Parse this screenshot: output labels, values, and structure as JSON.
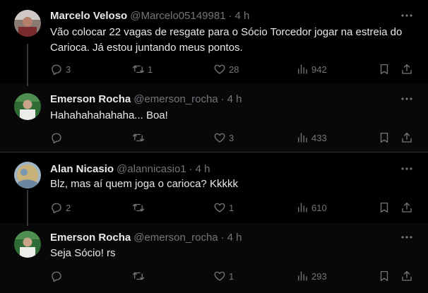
{
  "tweets": [
    {
      "name": "Marcelo Veloso",
      "handle": "@Marcelo05149981",
      "sep": "·",
      "time": "4 h",
      "text_line1": "Vão colocar 22 vagas de resgate para o Sócio Torcedor jogar na estreia do",
      "text_line2": "Carioca. Já estou juntando meus pontos.",
      "replies": "3",
      "retweets": "1",
      "likes": "28",
      "views": "942"
    },
    {
      "name": "Emerson Rocha",
      "handle": "@emerson_rocha",
      "sep": "·",
      "time": "4 h",
      "text_line1": "Hahahahahahaha... Boa!",
      "replies": "",
      "retweets": "",
      "likes": "3",
      "views": "433"
    },
    {
      "name": "Alan Nicasio",
      "handle": "@alannicasio1",
      "sep": "·",
      "time": "4 h",
      "text_line1": "Blz, mas aí quem joga o carioca? Kkkkk",
      "replies": "2",
      "retweets": "",
      "likes": "1",
      "views": "610"
    },
    {
      "name": "Emerson Rocha",
      "handle": "@emerson_rocha",
      "sep": "·",
      "time": "4 h",
      "text_line1": "Seja Sócio! rs",
      "replies": "",
      "retweets": "",
      "likes": "1",
      "views": "293"
    }
  ],
  "icons": {
    "reply": "reply-icon",
    "retweet": "retweet-icon",
    "like": "heart-icon",
    "views": "views-icon",
    "bookmark": "bookmark-icon",
    "share": "share-icon",
    "more": "more-icon"
  },
  "colors": {
    "background": "#000000",
    "text": "#e7e9ea",
    "secondary": "#71767b",
    "divider": "#2f3336"
  }
}
